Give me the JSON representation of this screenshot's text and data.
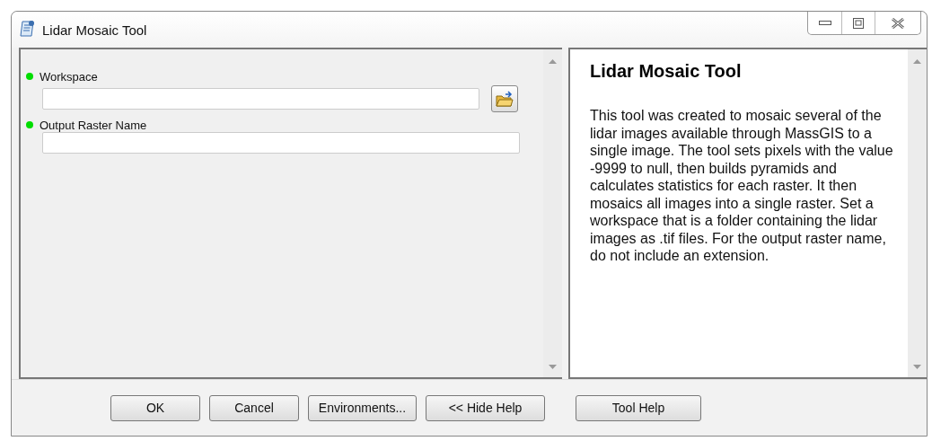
{
  "window": {
    "title": "Lidar Mosaic Tool"
  },
  "parameters": [
    {
      "label": "Workspace",
      "required": true,
      "kind": "folder"
    },
    {
      "label": "Output Raster Name",
      "required": true,
      "kind": "text"
    }
  ],
  "help": {
    "title": "Lidar Mosaic Tool",
    "body": "This tool was created to mosaic several of the lidar images available through MassGIS to a single image. The tool sets pixels with the value -9999 to null, then builds pyramids and calculates statistics for each raster. It then mosaics all images into a single raster. Set a workspace that is a folder containing the lidar images as .tif files. For the output raster name, do not include an extension."
  },
  "buttons": [
    "OK",
    "Cancel",
    "Environments...",
    "<< Hide Help",
    "Tool Help"
  ]
}
